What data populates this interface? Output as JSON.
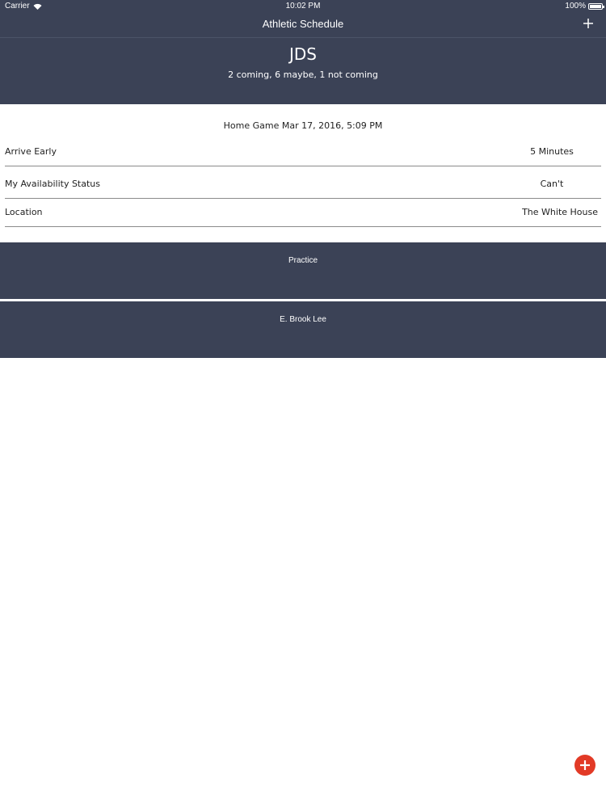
{
  "status_bar": {
    "carrier": "Carrier",
    "time": "10:02 PM",
    "battery": "100%",
    "battery_level": 1.0
  },
  "nav": {
    "title": "Athletic Schedule",
    "add_icon": "plus-icon"
  },
  "team": {
    "name": "JDS",
    "rsvp_summary": "2 coming, 6 maybe, 1 not coming"
  },
  "event": {
    "title": "Home Game Mar 17, 2016, 5:09 PM",
    "rows": [
      {
        "label": "Arrive Early",
        "value": "5 Minutes"
      },
      {
        "label": "My Availability Status",
        "value": "Can't"
      },
      {
        "label": "Location",
        "value": "The White House"
      }
    ]
  },
  "cards": [
    {
      "label": "Practice"
    },
    {
      "label": "E. Brook Lee"
    }
  ],
  "fab": {
    "icon": "plus-icon",
    "color": "#e23a26"
  },
  "colors": {
    "header_bg": "#3b4256",
    "accent": "#e23a26"
  }
}
